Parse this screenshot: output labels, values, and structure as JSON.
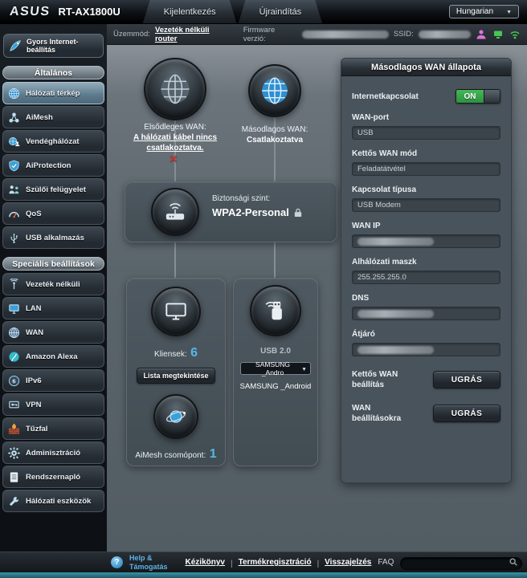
{
  "header": {
    "brand": "ASUS",
    "model": "RT-AX1800U",
    "logout_tab": "Kijelentkezés",
    "reboot_tab": "Újraindítás",
    "language": "Hungarian"
  },
  "statusbar": {
    "mode_label": "Üzemmód:",
    "mode_value": "Vezeték nélküli router",
    "firmware_label": "Firmware verzió:",
    "ssid_label": "SSID:"
  },
  "sidebar": {
    "quick_setup": "Gyors Internet-beállítás",
    "sections": {
      "general": "Általános",
      "advanced": "Speciális beállítások"
    },
    "general_items": [
      {
        "label": "Hálózati térkép",
        "icon": "network-map-icon",
        "active": true
      },
      {
        "label": "AiMesh",
        "icon": "aimesh-icon",
        "active": false
      },
      {
        "label": "Vendéghálózat",
        "icon": "guest-network-icon",
        "active": false
      },
      {
        "label": "AiProtection",
        "icon": "shield-icon",
        "active": false
      },
      {
        "label": "Szülői felügyelet",
        "icon": "parental-controls-icon",
        "active": false
      },
      {
        "label": "QoS",
        "icon": "gauge-icon",
        "active": false
      },
      {
        "label": "USB alkalmazás",
        "icon": "usb-icon",
        "active": false
      }
    ],
    "advanced_items": [
      {
        "label": "Vezeték nélküli",
        "icon": "antenna-icon"
      },
      {
        "label": "LAN",
        "icon": "monitor-icon"
      },
      {
        "label": "WAN",
        "icon": "globe-icon"
      },
      {
        "label": "Amazon Alexa",
        "icon": "alexa-icon"
      },
      {
        "label": "IPv6",
        "icon": "ipv6-globe-icon"
      },
      {
        "label": "VPN",
        "icon": "vpn-icon"
      },
      {
        "label": "Tűzfal",
        "icon": "firewall-icon"
      },
      {
        "label": "Adminisztráció",
        "icon": "gear-icon"
      },
      {
        "label": "Rendszernapló",
        "icon": "document-icon"
      },
      {
        "label": "Hálózati eszközök",
        "icon": "wrench-icon"
      }
    ]
  },
  "network_map": {
    "primary_wan": {
      "label": "Elsődleges WAN:",
      "status": "A hálózati kábel nincs csatlakoztatva."
    },
    "secondary_wan": {
      "label": "Másodlagos WAN:",
      "status": "Csatlakoztatva"
    },
    "security": {
      "label": "Biztonsági szint:",
      "value": "WPA2-Personal"
    },
    "clients": {
      "label": "Kliensek:",
      "count": "6",
      "view_list_button": "Lista megtekintése"
    },
    "aimesh": {
      "label": "AiMesh csomópont:",
      "count": "1"
    },
    "usb": {
      "version": "USB 2.0",
      "selected_option": "SAMSUNG _Andro",
      "device_name": "SAMSUNG _Android"
    }
  },
  "wan_status_panel": {
    "title": "Másodlagos WAN állapota",
    "internet": {
      "label": "Internetkapcsolat",
      "toggle": "ON"
    },
    "fields": [
      {
        "label": "WAN-port",
        "value": "USB",
        "redacted": false
      },
      {
        "label": "Kettős WAN mód",
        "value": "Feladatátvétel",
        "redacted": false
      },
      {
        "label": "Kapcsolat típusa",
        "value": "USB Modem",
        "redacted": false
      },
      {
        "label": "WAN IP",
        "value": "",
        "redacted": true
      },
      {
        "label": "Alhálózati maszk",
        "value": "255.255.255.0",
        "redacted": false
      },
      {
        "label": "DNS",
        "value": "",
        "redacted": true
      },
      {
        "label": "Átjáró",
        "value": "",
        "redacted": true
      }
    ],
    "actions": [
      {
        "label": "Kettős WAN beállítás",
        "button": "UGRÁS"
      },
      {
        "label": "WAN beállításokra",
        "button": "UGRÁS"
      }
    ]
  },
  "footer": {
    "help": "Help & Támogatás",
    "links": [
      "Kézikönyv",
      "Termékregisztráció",
      "Visszajelzés"
    ],
    "faq_label": "FAQ"
  },
  "colors": {
    "toggle_on_green": "#35a948",
    "count_blue": "#58b7e6",
    "link_blue": "#5fb3e4",
    "disconnect_red": "#c0392b"
  }
}
